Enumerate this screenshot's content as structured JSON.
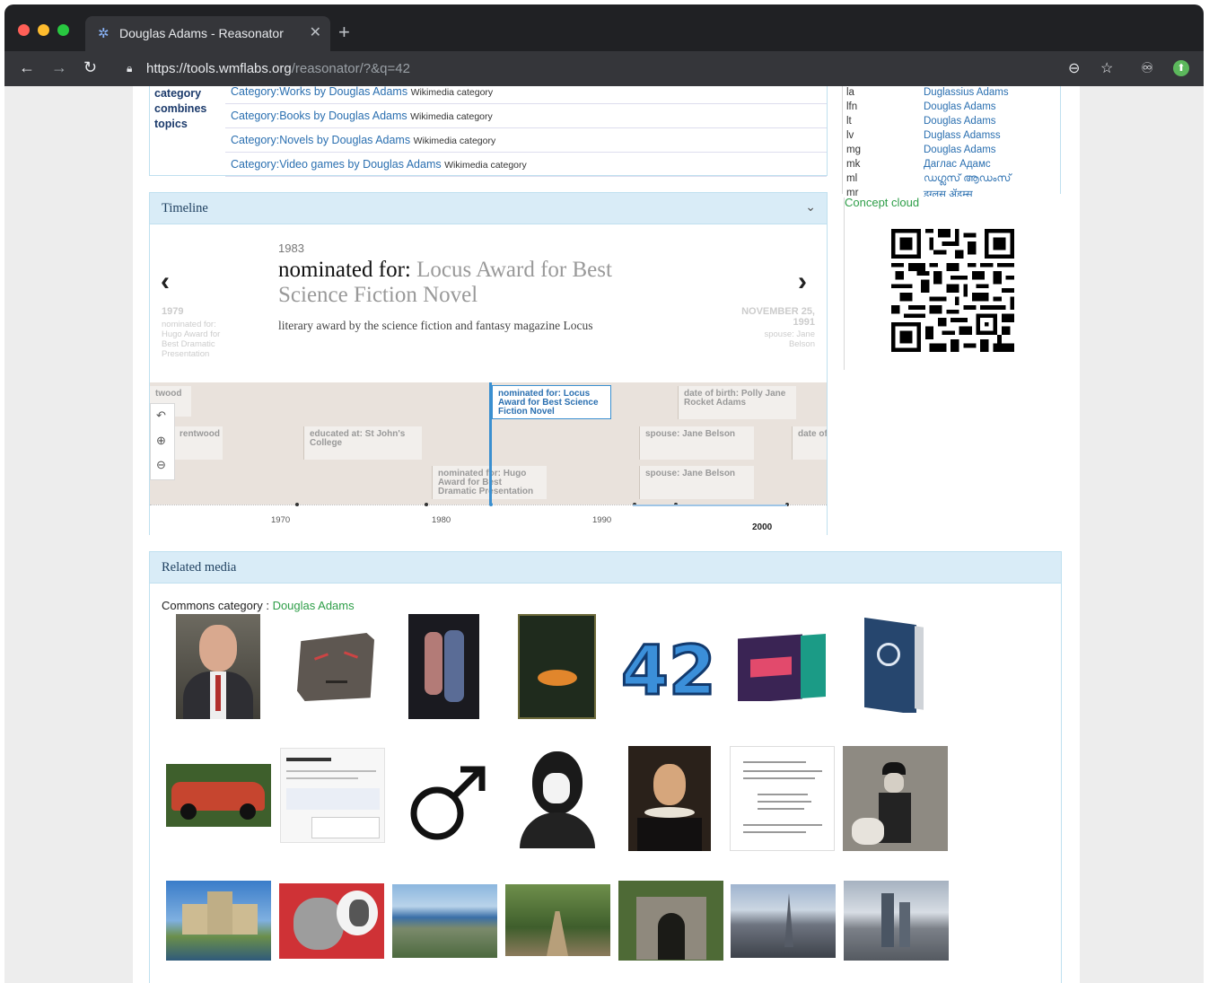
{
  "browser": {
    "tab_title": "Douglas Adams - Reasonator",
    "url_host": "https://tools.wmflabs.org",
    "url_path": "/reasonator/?&q=42",
    "icons": [
      "back-icon",
      "forward-icon",
      "reload-icon",
      "lock-icon",
      "zoom-icon",
      "star-icon",
      "incognito-icon",
      "extension-icon"
    ]
  },
  "categories": {
    "label": "category combines topics",
    "rows": [
      {
        "link": "Category:Works by Douglas Adams",
        "desc": "Wikimedia category"
      },
      {
        "link": "Category:Books by Douglas Adams",
        "desc": "Wikimedia category"
      },
      {
        "link": "Category:Novels by Douglas Adams",
        "desc": "Wikimedia category"
      },
      {
        "link": "Category:Video games by Douglas Adams",
        "desc": "Wikimedia category"
      }
    ]
  },
  "languages": [
    {
      "code": "la",
      "name": "Duglassius Adams"
    },
    {
      "code": "lfn",
      "name": "Douglas Adams"
    },
    {
      "code": "lt",
      "name": "Douglas Adams"
    },
    {
      "code": "lv",
      "name": "Duglass Adamss"
    },
    {
      "code": "mg",
      "name": "Douglas Adams"
    },
    {
      "code": "mk",
      "name": "Даглас Адамс"
    },
    {
      "code": "ml",
      "name": "ഡഗ്ലസ് ആഡംസ്"
    },
    {
      "code": "mr",
      "name": "डग्लस ॲडम्स"
    }
  ],
  "concept_cloud": "Concept cloud",
  "timeline": {
    "title": "Timeline",
    "year": "1983",
    "headline_prefix": "nominated for:",
    "headline_value": "Locus Award for Best Science Fiction Novel",
    "description": "literary award by the science fiction and fantasy magazine Locus",
    "prev": {
      "date": "1979",
      "text": "nominated for: Hugo Award for Best Dramatic Presentation"
    },
    "next": {
      "date": "NOVEMBER 25, 1991",
      "text": "spouse: Jane Belson"
    },
    "flags": {
      "twood": "twood",
      "rentwood": "rentwood",
      "college": "educated at: St John's College",
      "hugo": "nominated for: Hugo Award for Best Dramatic Presentation",
      "locus": "nominated for: Locus Award for Best Science Fiction Novel",
      "birth": "date of birth: Polly Jane Rocket Adams",
      "spouse1": "spouse: Jane Belson",
      "spouse2": "spouse: Jane Belson",
      "dateof": "date of"
    },
    "ticks": [
      "1970",
      "1980",
      "1990",
      "2000"
    ]
  },
  "related_media": {
    "title": "Related media",
    "commons_label": "Commons category :",
    "commons_link": "Douglas Adams"
  }
}
